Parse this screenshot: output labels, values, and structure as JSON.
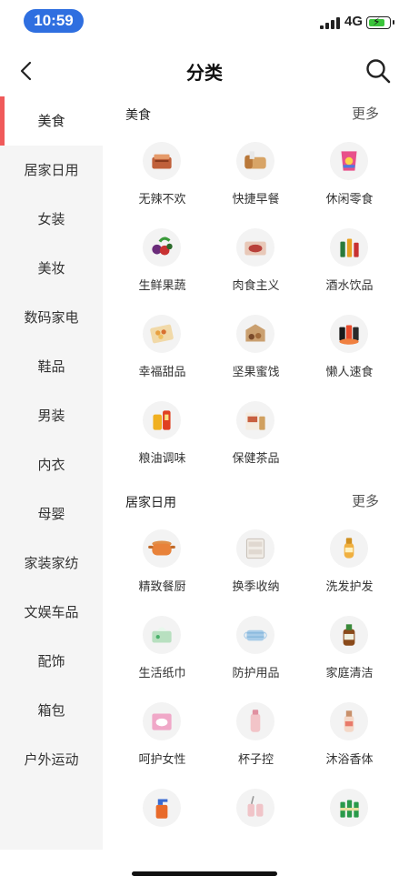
{
  "status": {
    "time": "10:59",
    "network": "4G"
  },
  "nav": {
    "title": "分类"
  },
  "sidebar": {
    "items": [
      {
        "label": "美食",
        "active": true
      },
      {
        "label": "居家日用"
      },
      {
        "label": "女装"
      },
      {
        "label": "美妆"
      },
      {
        "label": "数码家电"
      },
      {
        "label": "鞋品"
      },
      {
        "label": "男装"
      },
      {
        "label": "内衣"
      },
      {
        "label": "母婴"
      },
      {
        "label": "家装家纺"
      },
      {
        "label": "文娱车品"
      },
      {
        "label": "配饰"
      },
      {
        "label": "箱包"
      },
      {
        "label": "户外运动"
      }
    ]
  },
  "sections": [
    {
      "title": "美食",
      "more": "更多",
      "items": [
        {
          "label": "无辣不欢",
          "icon": "spicy-meat-icon"
        },
        {
          "label": "快捷早餐",
          "icon": "bread-icon"
        },
        {
          "label": "休闲零食",
          "icon": "chips-bag-icon"
        },
        {
          "label": "生鲜果蔬",
          "icon": "fruit-veg-icon"
        },
        {
          "label": "肉食主义",
          "icon": "meat-box-icon"
        },
        {
          "label": "酒水饮品",
          "icon": "drink-bottles-icon"
        },
        {
          "label": "幸福甜品",
          "icon": "dessert-box-icon"
        },
        {
          "label": "坚果蜜饯",
          "icon": "nuts-box-icon"
        },
        {
          "label": "懒人速食",
          "icon": "instant-food-icon"
        },
        {
          "label": "粮油调味",
          "icon": "oil-rice-icon"
        },
        {
          "label": "保健茶品",
          "icon": "tea-box-icon"
        }
      ]
    },
    {
      "title": "居家日用",
      "more": "更多",
      "items": [
        {
          "label": "精致餐厨",
          "icon": "cooking-pot-icon"
        },
        {
          "label": "换季收纳",
          "icon": "storage-drawer-icon"
        },
        {
          "label": "洗发护发",
          "icon": "shampoo-bottle-icon"
        },
        {
          "label": "生活纸巾",
          "icon": "tissue-pack-icon"
        },
        {
          "label": "防护用品",
          "icon": "face-mask-icon"
        },
        {
          "label": "家庭清洁",
          "icon": "disinfectant-bottle-icon"
        },
        {
          "label": "呵护女性",
          "icon": "sanitary-pad-icon"
        },
        {
          "label": "杯子控",
          "icon": "water-cup-icon"
        },
        {
          "label": "沐浴香体",
          "icon": "body-wash-icon"
        },
        {
          "label": "",
          "icon": "spray-cleaner-icon"
        },
        {
          "label": "",
          "icon": "cup-set-icon"
        },
        {
          "label": "",
          "icon": "green-bottles-icon"
        }
      ]
    }
  ],
  "colors": {
    "accent": "#f05a5a",
    "sidebar_bg": "#f5f5f5",
    "time_pill": "#2f6fe0"
  }
}
